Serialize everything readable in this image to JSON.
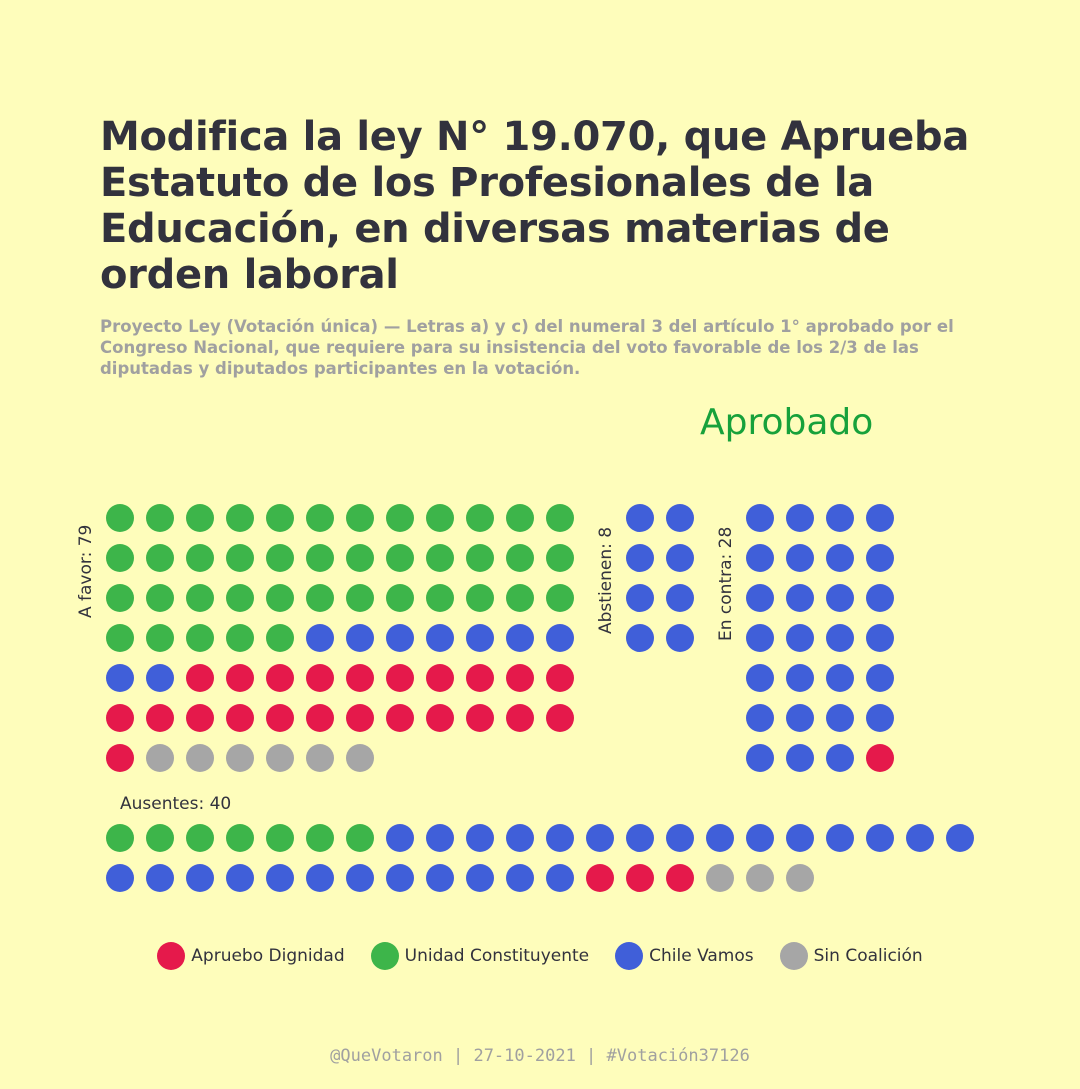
{
  "title": "Modifica la ley N° 19.070, que Aprueba Estatuto de los Profesionales de la Educación, en diversas materias de orden laboral",
  "subtitle": "Proyecto Ley (Votación única) — Letras a) y c) del numeral 3 del artículo 1° aprobado por el Congreso Nacional, que requiere para su insistencia del voto favorable de los 2/3 de las diputadas y diputados participantes en la votación.",
  "result": "Aprobado",
  "colors": {
    "background": "#fefdbb",
    "apruebo_dignidad": "#e5194b",
    "unidad_constituyente": "#3db54a",
    "chile_vamos": "#405fd9",
    "sin_coalicion": "#a6a6a6",
    "result": "#17a13b"
  },
  "chart_data": {
    "type": "dot-matrix",
    "title": "Modifica la ley N° 19.070, que Aprueba Estatuto de los Profesionales de la Educación, en diversas materias de orden laboral",
    "result": "Aprobado",
    "series": [
      {
        "name": "Apruebo Dignidad",
        "color": "#e5194b"
      },
      {
        "name": "Unidad Constituyente",
        "color": "#3db54a"
      },
      {
        "name": "Chile Vamos",
        "color": "#405fd9"
      },
      {
        "name": "Sin Coalición",
        "color": "#a6a6a6"
      }
    ],
    "groups": [
      {
        "key": "a_favor",
        "label": "A favor: 79",
        "total": 79,
        "composition": {
          "Unidad Constituyente": 41,
          "Chile Vamos": 9,
          "Apruebo Dignidad": 23,
          "Sin Coalición": 6
        }
      },
      {
        "key": "abstienen",
        "label": "Abstienen: 8",
        "total": 8,
        "composition": {
          "Chile Vamos": 8
        }
      },
      {
        "key": "en_contra",
        "label": "En contra: 28",
        "total": 28,
        "composition": {
          "Chile Vamos": 27,
          "Apruebo Dignidad": 1
        }
      },
      {
        "key": "ausentes",
        "label": "Ausentes: 40",
        "total": 40,
        "composition": {
          "Unidad Constituyente": 7,
          "Chile Vamos": 27,
          "Apruebo Dignidad": 3,
          "Sin Coalición": 3
        }
      }
    ]
  },
  "legend": [
    {
      "label": "Apruebo Dignidad",
      "color": "#e5194b"
    },
    {
      "label": "Unidad Constituyente",
      "color": "#3db54a"
    },
    {
      "label": "Chile Vamos",
      "color": "#405fd9"
    },
    {
      "label": "Sin Coalición",
      "color": "#a6a6a6"
    }
  ],
  "footer": "@QueVotaron   |   27-10-2021   |   #Votación37126"
}
